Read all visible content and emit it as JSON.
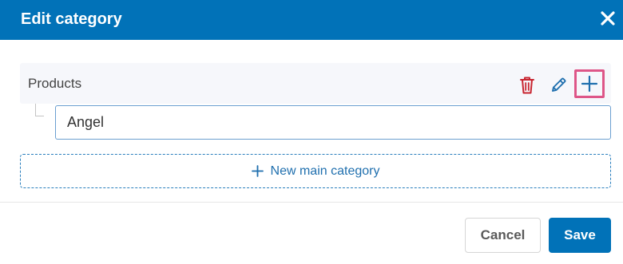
{
  "dialog": {
    "title": "Edit category",
    "close_icon": "close-icon"
  },
  "category": {
    "name": "Products",
    "actions": {
      "delete_icon": "trash-icon",
      "edit_icon": "pencil-icon",
      "add_subcategory_icon": "plus-icon"
    },
    "subcategory": {
      "value": "Angel"
    }
  },
  "new_main_category": {
    "label": "New main category",
    "icon": "plus-icon"
  },
  "footer": {
    "cancel_label": "Cancel",
    "save_label": "Save"
  },
  "colors": {
    "header_bg": "#0172b8",
    "accent": "#1f6fae",
    "delete": "#c8242f",
    "highlight_border": "#de5688",
    "row_bg": "#f6f7fb"
  }
}
